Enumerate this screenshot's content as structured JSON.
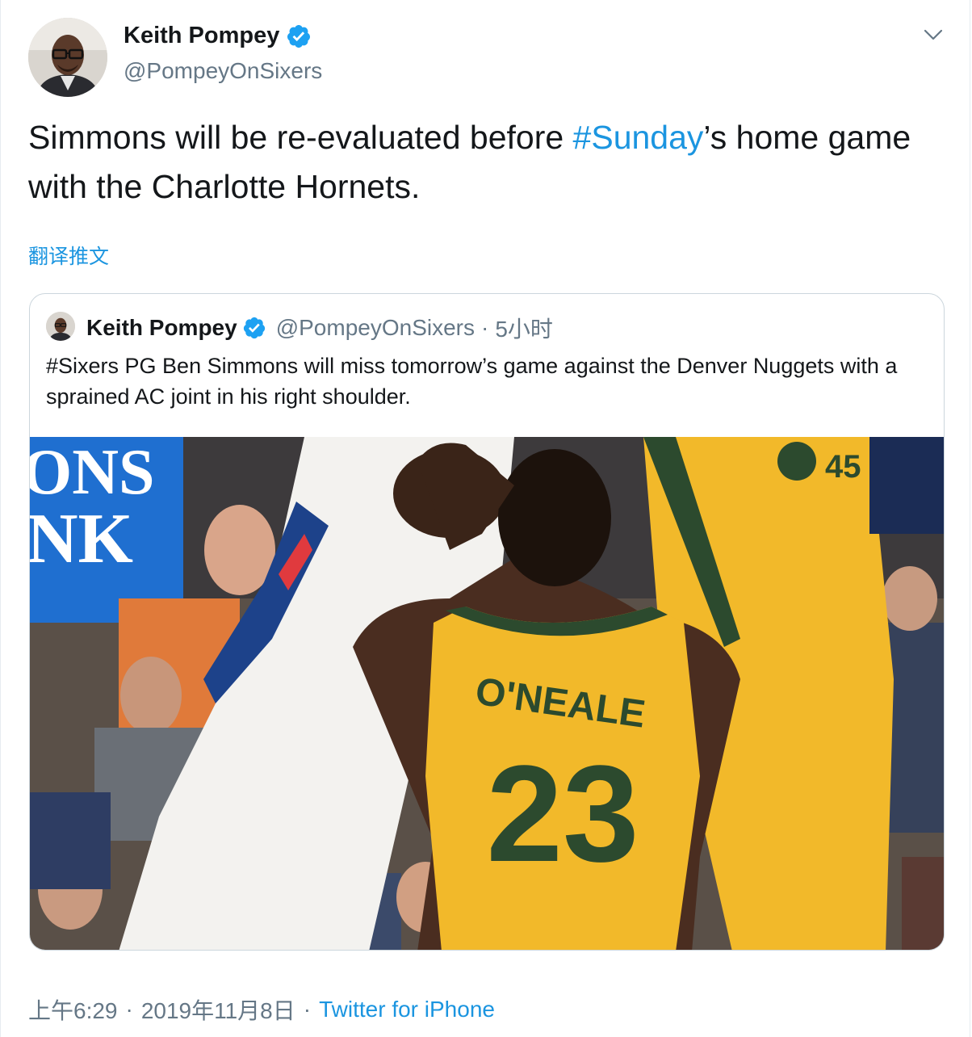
{
  "tweet": {
    "author_name": "Keith Pompey",
    "author_handle": "@PompeyOnSixers",
    "text_before": "Simmons will be re-evaluated before ",
    "hashtag": "#Sunday",
    "text_after": "’s home game with the Charlotte Hornets.",
    "translate_label": "翻译推文",
    "time": "上午6:29",
    "date": "2019年11月8日",
    "source": "Twitter for iPhone",
    "separator": "·"
  },
  "quoted_tweet": {
    "author_name": "Keith Pompey",
    "author_handle": "@PompeyOnSixers",
    "separator": "·",
    "time_ago": "5小时",
    "text": "#Sixers PG Ben Simmons will miss tomorrow’s game against the Denver Nuggets with a sprained AC joint in his right shoulder.",
    "image": {
      "banner_text_1": "ONS",
      "banner_text_2": "NK",
      "jersey_name": "O'NEALE",
      "jersey_number": "23",
      "jersey_number_2": "45"
    }
  },
  "colors": {
    "link_blue": "#1b95e0",
    "verified_blue": "#1da1f2",
    "muted_gray": "#657786",
    "border": "#ccd6dd",
    "jazz_yellow": "#f2b92a",
    "jazz_green": "#2c4a2e",
    "sixers_blue": "#1d428a"
  },
  "icons": [
    "verified-icon",
    "chevron-down-icon"
  ]
}
